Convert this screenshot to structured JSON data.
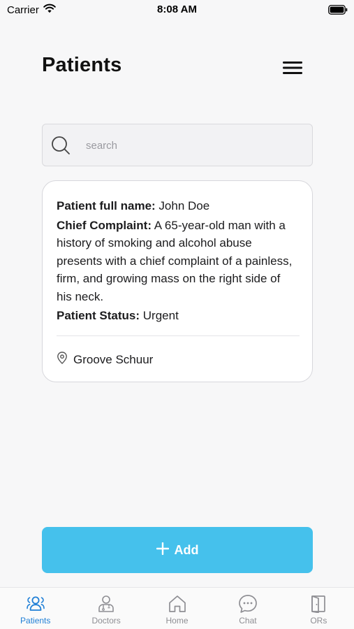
{
  "status_bar": {
    "carrier": "Carrier",
    "time": "8:08 AM"
  },
  "header": {
    "title": "Patients"
  },
  "search": {
    "placeholder": "search",
    "value": ""
  },
  "patients": [
    {
      "name_label": "Patient full name:",
      "name": "John Doe",
      "complaint_label": "Chief Complaint:",
      "complaint": "A 65-year-old man with a history of smoking and alcohol abuse presents with a chief complaint of a painless, firm, and growing mass on the right side of his neck.",
      "status_label": "Patient Status:",
      "status": "Urgent",
      "location": "Groove Schuur"
    }
  ],
  "actions": {
    "add_label": "Add"
  },
  "tab_bar": {
    "items": [
      {
        "label": "Patients",
        "icon": "patients-icon",
        "active": true
      },
      {
        "label": "Doctors",
        "icon": "doctor-icon",
        "active": false
      },
      {
        "label": "Home",
        "icon": "home-icon",
        "active": false
      },
      {
        "label": "Chat",
        "icon": "chat-icon",
        "active": false
      },
      {
        "label": "ORs",
        "icon": "door-icon",
        "active": false
      }
    ]
  },
  "colors": {
    "accent": "#45c1ec",
    "active_tab": "#1f7fd6",
    "inactive_tab": "#8e8e93",
    "background": "#f7f7f8"
  }
}
